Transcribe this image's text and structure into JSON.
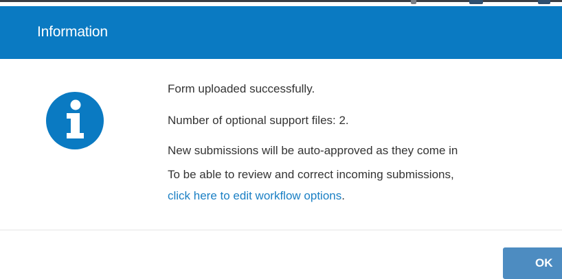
{
  "dialog": {
    "title": "Information",
    "icon": "info-icon",
    "messages": {
      "line1": "Form uploaded successfully.",
      "line2": "Number of optional support files: 2.",
      "line3": "New submissions will be auto-approved as they come in",
      "line4": "To be able to review and correct incoming submissions,",
      "link_text": "click here to edit workflow options",
      "link_suffix": "."
    },
    "ok_label": "OK"
  },
  "colors": {
    "header": "#0a7ac2",
    "link": "#1a7fc4",
    "button": "#4d8cc1",
    "text": "#333333"
  }
}
